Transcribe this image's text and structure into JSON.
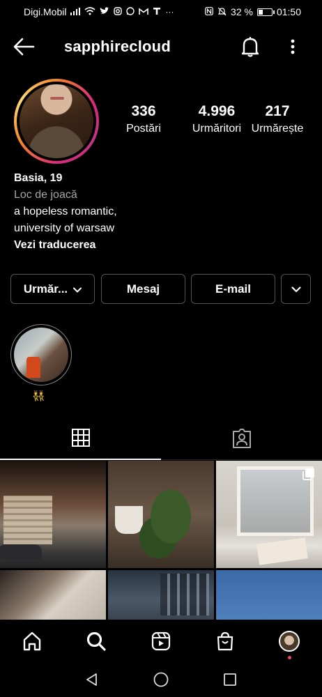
{
  "status_bar": {
    "carrier": "Digi.Mobil",
    "battery_percent": "32 %",
    "time": "01:50",
    "extra_icons_label": "···"
  },
  "header": {
    "username": "sapphirecloud"
  },
  "profile": {
    "stats": [
      {
        "value": "336",
        "label": "Postări"
      },
      {
        "value": "4.996",
        "label": "Urmăritori"
      },
      {
        "value": "217",
        "label": "Urmărește"
      }
    ],
    "name": "Basia, 19",
    "category": "Loc de joacă",
    "bio_line1": "a hopeless romantic,",
    "bio_line2": "university of warsaw",
    "translate": "Vezi traducerea"
  },
  "actions": {
    "follow": "Urmăr...",
    "message": "Mesaj",
    "email": "E-mail"
  },
  "highlights": [
    {
      "label": "👯"
    }
  ],
  "colors": {
    "background": "#000000",
    "border": "#555555",
    "secondary_text": "#a8a8a8",
    "notification_dot": "#ed4956"
  },
  "icons": [
    "back-arrow-icon",
    "bell-icon",
    "more-vertical-icon",
    "grid-icon",
    "tagged-icon",
    "home-icon",
    "search-icon",
    "reels-icon",
    "shop-icon",
    "multi-post-icon"
  ]
}
